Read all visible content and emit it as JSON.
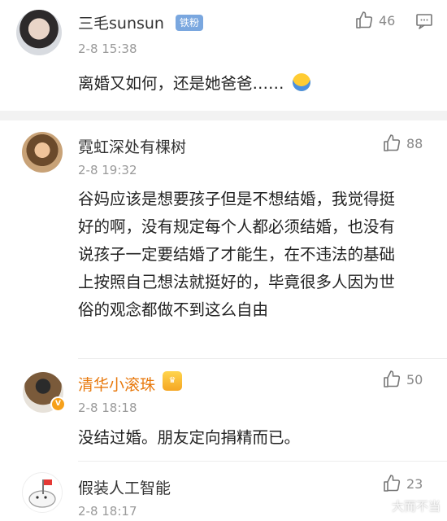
{
  "top_comment": {
    "username": "三毛sunsun",
    "fan_badge": "铁粉",
    "time": "2-8 15:38",
    "text": "离婚又如何，还是她爸爸……",
    "likes": "46"
  },
  "replies": [
    {
      "username": "霓虹深处有棵树",
      "time": "2-8 19:32",
      "text": "谷妈应该是想要孩子但是不想结婚，我觉得挺好的啊，没有规定每个人都必须结婚，也没有说孩子一定要结婚了才能生，在不违法的基础上按照自己想法就挺好的，毕竟很多人因为世俗的观念都做不到这么自由",
      "likes": "88"
    },
    {
      "username": "清华小滚珠",
      "time": "2-8 18:18",
      "text": "没结过婚。朋友定向捐精而已。",
      "likes": "50",
      "name_color": "#e8790d"
    },
    {
      "username": "假装人工智能",
      "time": "2-8 18:17",
      "likes": "23"
    }
  ],
  "watermark": "大而不当"
}
